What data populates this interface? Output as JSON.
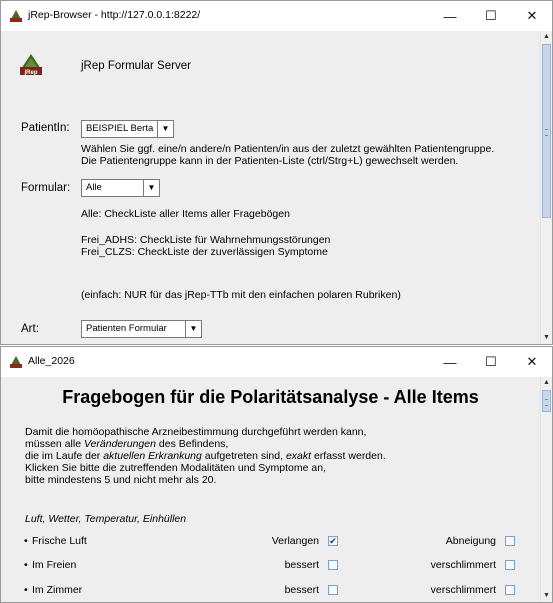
{
  "window1": {
    "title": "jRep-Browser - http://127.0.0.1:8222/",
    "header": "jRep Formular Server",
    "logo_text": "jRep",
    "patient": {
      "label": "PatientIn:",
      "value": "BEISPIEL Berta",
      "help_line1": "Wählen Sie ggf. eine/n andere/n Patienten/in aus der zuletzt gewählten Patientengruppe.",
      "help_line2": "Die Patientengruppe kann in der Patienten-Liste (ctrl/Strg+L) gewechselt werden."
    },
    "formular": {
      "label": "Formular:",
      "value": "Alle",
      "desc_alle": "Alle: CheckListe aller Items aller Fragebögen",
      "desc_adhs": "Frei_ADHS: CheckListe für Wahrnehmungsstörungen",
      "desc_clzs": "Frei_CLZS: CheckListe der zuverlässigen Symptome",
      "desc_einfach": "(einfach: NUR für das jRep-TTb mit den einfachen polaren Rubriken)"
    },
    "art": {
      "label": "Art:",
      "value": "Patienten Formular"
    },
    "scroll_position": 0.0
  },
  "window2": {
    "title": "Alle_2026",
    "heading": "Fragebogen für die Polaritätsanalyse - Alle Items",
    "intro": {
      "l1": "Damit die homöopathische Arzneibestimmung durchgeführt werden kann,",
      "l2a": "müssen alle ",
      "l2b": "Veränderungen",
      "l2c": " des Befindens,",
      "l3a": "die im Laufe der ",
      "l3b": "aktuellen Erkrankung",
      "l3c": " aufgetreten sind, ",
      "l3d": "exakt",
      "l3e": " erfasst werden.",
      "l4": "Klicken Sie bitte die zutreffenden Modalitäten und Symptome an,",
      "l5": "bitte mindestens 5 und nicht mehr als 20."
    },
    "section": "Luft, Wetter, Temperatur, Einhüllen",
    "rows": [
      {
        "label": "Frische Luft",
        "left_label": "Verlangen",
        "left_checked": true,
        "right_label": "Abneigung",
        "right_checked": false
      },
      {
        "label": "Im Freien",
        "left_label": "bessert",
        "left_checked": false,
        "right_label": "verschlimmert",
        "right_checked": false
      },
      {
        "label": "Im Zimmer",
        "left_label": "bessert",
        "left_checked": false,
        "right_label": "verschlimmert",
        "right_checked": false
      }
    ],
    "bullet": "•"
  },
  "controls": {
    "minimize": "—",
    "maximize": "☐",
    "close": "✕"
  }
}
